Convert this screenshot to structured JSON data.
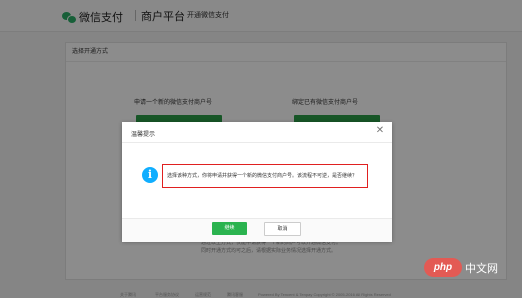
{
  "header": {
    "brand": "微信支付",
    "platform": "商户平台",
    "subtitle": "开通微信支付"
  },
  "card": {
    "heading": "选择开通方式",
    "option_new": "申请一个新的微信支付商户号",
    "option_bind": "绑定已有微信支付商户号",
    "note_1": "通过以上方式，仅能申请获得一个新的商户号以开通微信支付。",
    "note_2": "同时开通方式均可之后，请根据实际业务情况选择开通方式。"
  },
  "dialog": {
    "title": "温馨提示",
    "close_icon": "close-icon",
    "info_icon": "info-icon",
    "message": "选择该种方式，你将申请并获得一个新的微信支付商户号。该流程不可逆，是否继续？",
    "confirm_label": "继续",
    "cancel_label": "取消"
  },
  "footer": {
    "links": [
      "关于腾讯",
      "平台服务协议",
      "运营规范",
      "腾讯客服"
    ],
    "copyright": "Powered By Tencent & Tenpay   Copyright © 2005-2016 All Rights Reserved"
  },
  "watermark": {
    "php": "php",
    "site": "中文网"
  },
  "colors": {
    "accent_green": "#2bb34f",
    "info_blue": "#10aeff",
    "highlight_red": "#e02020"
  }
}
